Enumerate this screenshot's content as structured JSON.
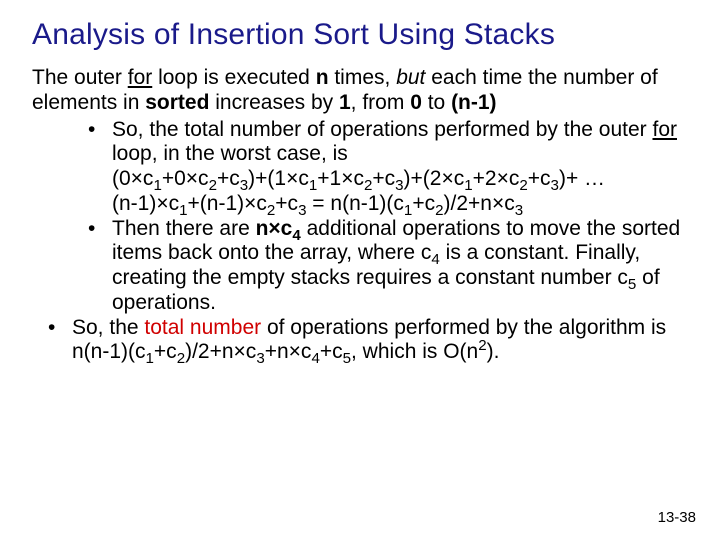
{
  "title": "Analysis of Insertion Sort Using Stacks",
  "intro": {
    "t1": "The outer ",
    "for": "for",
    "t2": " loop is executed ",
    "n": "n",
    "t3": " times, ",
    "but": "but",
    "t4": " each time the number of elements in ",
    "sorted": "sorted",
    "t5": " increases by ",
    "one": "1",
    "t6": ", from ",
    "zero": "0",
    "t7": " to ",
    "nminus1": "(n-1)"
  },
  "b1": {
    "t1": "So, the total number of operations performed by the outer ",
    "for": "for",
    "t2": " loop, in the worst case, is",
    "line2a": "(0×c",
    "line2b": "+0×c",
    "line2c": "+c",
    "line2d": ")+(1×c",
    "line2e": "+1×c",
    "line2f": "+c",
    "line2g": ")+(2×c",
    "line2h": "+2×c",
    "line2i": "+c",
    "line2j": ")+ …",
    "line3a": "(n-1)×c",
    "line3b": "+(n-1)×c",
    "line3c": "+c",
    "line3d": "  = n(n-1)(c",
    "line3e": "+c",
    "line3f": ")/2+n×c"
  },
  "b2": {
    "t1": "Then there are ",
    "nxc4": "n×c",
    "t2": " additional operations to move the sorted items back onto the array, where c",
    "t3": " is a constant. Finally, creating the empty stacks requires a constant number c",
    "t4": " of operations."
  },
  "b3": {
    "t1": "So, the ",
    "total": "total number",
    "t2": " of operations performed by the algorithm is n(n-1)(c",
    "t3": "+c",
    "t4": ")/2+n×c",
    "t5": "+n×c",
    "t6": "+c",
    "t7": ", which is O(n",
    "t8": ")."
  },
  "sub": {
    "1": "1",
    "2": "2",
    "3": "3",
    "4": "4",
    "5": "5"
  },
  "sup2": "2",
  "pagenum": "13-38"
}
